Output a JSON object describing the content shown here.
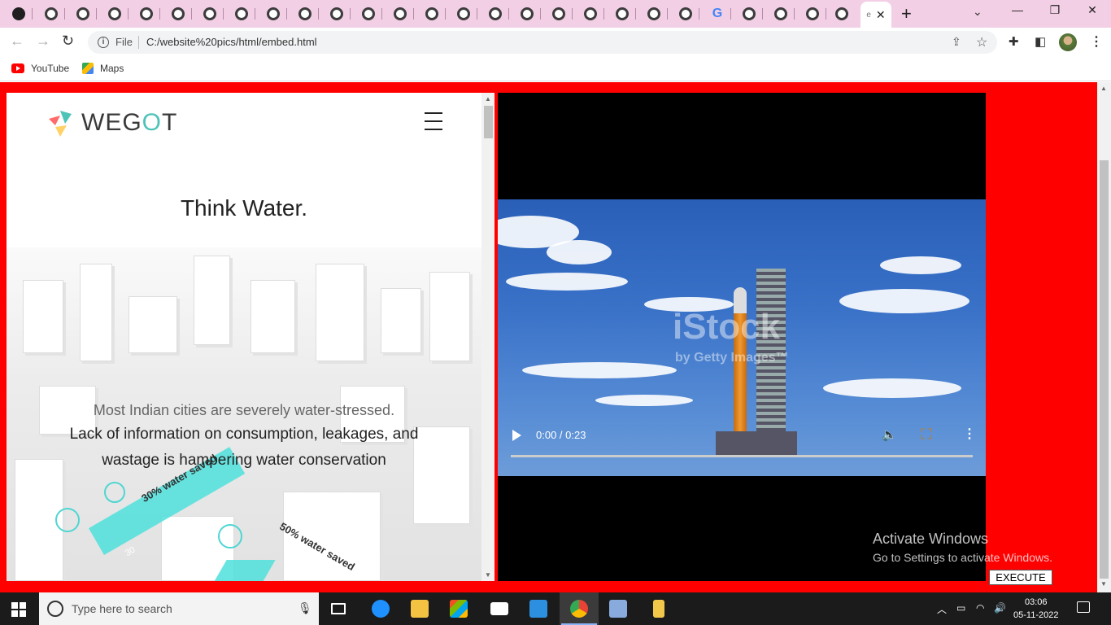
{
  "browser": {
    "active_tab_favicon": "e",
    "tab_close": "✕",
    "new_tab": "+",
    "window": {
      "minimize": "—",
      "restore": "❐",
      "close": "✕"
    },
    "nav": {
      "back": "←",
      "forward": "→",
      "reload": "↻"
    },
    "address": {
      "scheme_label": "File",
      "url": "C:/website%20pics/html/embed.html"
    },
    "bookmarks": [
      {
        "label": "YouTube",
        "icon": "youtube-icon"
      },
      {
        "label": "Maps",
        "icon": "maps-icon"
      }
    ]
  },
  "iframe": {
    "brand_prefix": "WEG",
    "brand_o": "O",
    "brand_suffix": "T",
    "tagline": "Think Water.",
    "stat_line1": "Most Indian cities are severely water-stressed.",
    "stat_line2": "Lack of information on consumption, leakages, and wastage is hampering water conservation",
    "label_30": "30% water saved",
    "label_50": "50% water saved",
    "tile_30": "30"
  },
  "video": {
    "watermark": "iStock",
    "watermark_sub": "by Getty Images™",
    "timecode": "0:00 / 0:23",
    "progress": 0
  },
  "overlay": {
    "activate_title": "Activate Windows",
    "activate_sub": "Go to Settings to activate Windows.",
    "execute": "EXECUTE"
  },
  "taskbar": {
    "search_placeholder": "Type here to search",
    "time": "03:06",
    "date": "05-11-2022"
  },
  "colors": {
    "page_bg": "#ff0000",
    "tab_strip": "#f2cfe5",
    "accent": "#4fc3b8"
  }
}
